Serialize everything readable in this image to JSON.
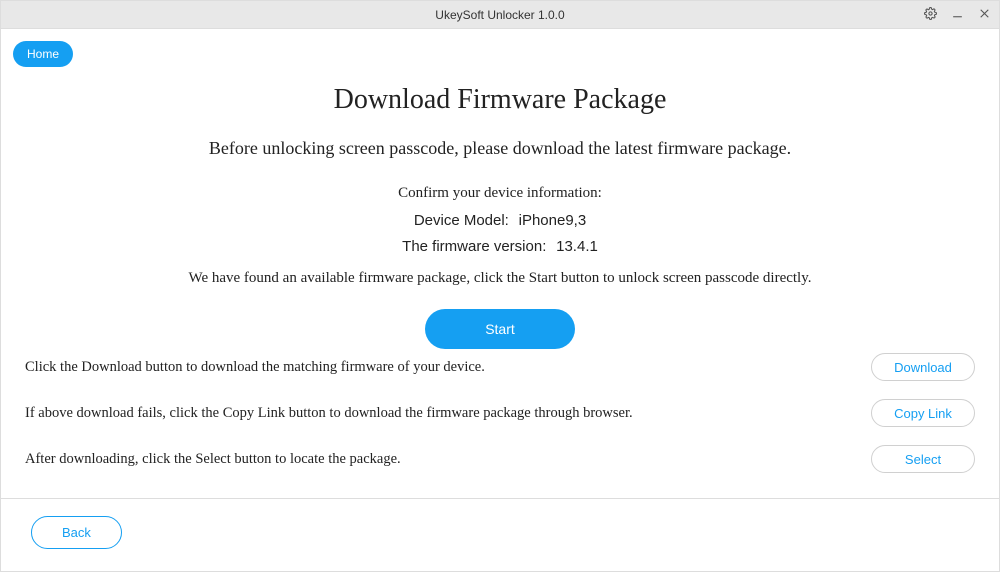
{
  "titlebar": {
    "title": "UkeySoft Unlocker 1.0.0"
  },
  "nav": {
    "home_label": "Home"
  },
  "main": {
    "title": "Download Firmware Package",
    "subtitle": "Before unlocking screen passcode, please download the latest firmware package.",
    "confirm_text": "Confirm your device information:",
    "device_model_label": "Device Model:",
    "device_model_value": "iPhone9,3",
    "firmware_label": "The firmware version:",
    "firmware_value": "13.4.1",
    "found_text": "We have found an available firmware package, click the Start button to unlock screen passcode directly.",
    "start_label": "Start"
  },
  "instructions": {
    "download_text": "Click the Download button to download the matching firmware of your device.",
    "copylink_text": "If above download fails, click the Copy Link button to download the firmware package through browser.",
    "select_text": "After downloading, click the Select button to locate the package.",
    "download_label": "Download",
    "copylink_label": "Copy Link",
    "select_label": "Select"
  },
  "footer": {
    "back_label": "Back"
  }
}
